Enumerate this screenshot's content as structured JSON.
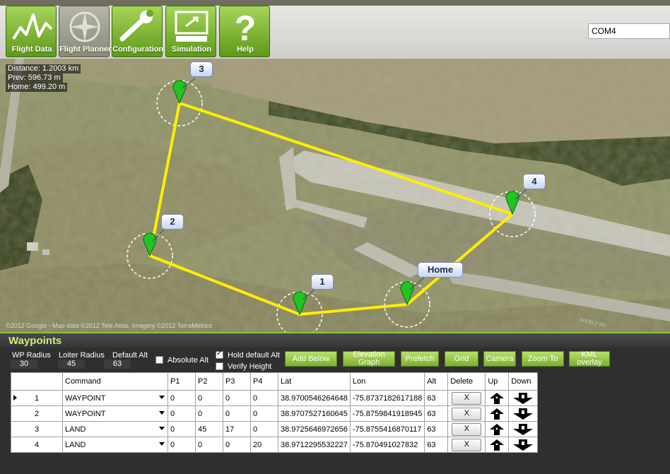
{
  "toolbar": {
    "buttons": [
      {
        "label": "Flight Data",
        "icon": "flight-data-icon"
      },
      {
        "label": "Flight Planner",
        "icon": "compass-icon"
      },
      {
        "label": "Configuration",
        "icon": "wrench-icon"
      },
      {
        "label": "Simulation",
        "icon": "simulation-icon"
      },
      {
        "label": "Help",
        "icon": "help-icon"
      }
    ],
    "com_port": "COM4"
  },
  "map": {
    "distance": "Distance: 1.2003 km",
    "prev": "Prev: 596.73 m",
    "home": "Home: 499.20 m",
    "copyright": "©2012 Google - Map data ©2012 Tele Atlas, Imagery ©2012 TerraMetrics",
    "road_label": "WIDELY RD",
    "markers": [
      "1",
      "2",
      "3",
      "4",
      "Home"
    ],
    "path_color": "#ffee00",
    "marker_color": "#22c322"
  },
  "waypoints": {
    "title": "Waypoints",
    "wp_radius_label": "WP Radius",
    "wp_radius": "30",
    "loiter_radius_label": "Loiter Radius",
    "loiter_radius": "45",
    "default_alt_label": "Default Alt",
    "default_alt": "63",
    "absolute_alt_label": "Absolute Alt",
    "absolute_alt_checked": false,
    "hold_default_alt_label": "Hold default Alt",
    "hold_default_alt_checked": true,
    "verify_height_label": "Verify Height",
    "verify_height_checked": false,
    "buttons": {
      "add_below": "Add Below",
      "elevation_graph": "Elevation Graph",
      "prefetch": "Prefetch",
      "grid": "Grid",
      "camera": "Camera",
      "zoom_to": "Zoom To",
      "kml_overlay": "KML overlay"
    },
    "columns": [
      "Command",
      "P1",
      "P2",
      "P3",
      "P4",
      "Lat",
      "Lon",
      "Alt",
      "Delete",
      "Up",
      "Down"
    ],
    "delete_label": "X",
    "rows": [
      {
        "n": "1",
        "command": "WAYPOINT",
        "p1": "0",
        "p2": "0",
        "p3": "0",
        "p4": "0",
        "lat": "38.9700546264648",
        "lon": "-75.8737182617188",
        "alt": "63"
      },
      {
        "n": "2",
        "command": "WAYPOINT",
        "p1": "0",
        "p2": "0",
        "p3": "0",
        "p4": "0",
        "lat": "38.9707527160645",
        "lon": "-75.8759841918945",
        "alt": "63"
      },
      {
        "n": "3",
        "command": "LAND",
        "p1": "0",
        "p2": "45",
        "p3": "17",
        "p4": "0",
        "lat": "38.9725646972656",
        "lon": "-75.8755416870117",
        "alt": "63"
      },
      {
        "n": "4",
        "command": "LAND",
        "p1": "0",
        "p2": "0",
        "p3": "0",
        "p4": "20",
        "lat": "38.9712295532227",
        "lon": "-75.870491027832",
        "alt": "63"
      }
    ]
  }
}
